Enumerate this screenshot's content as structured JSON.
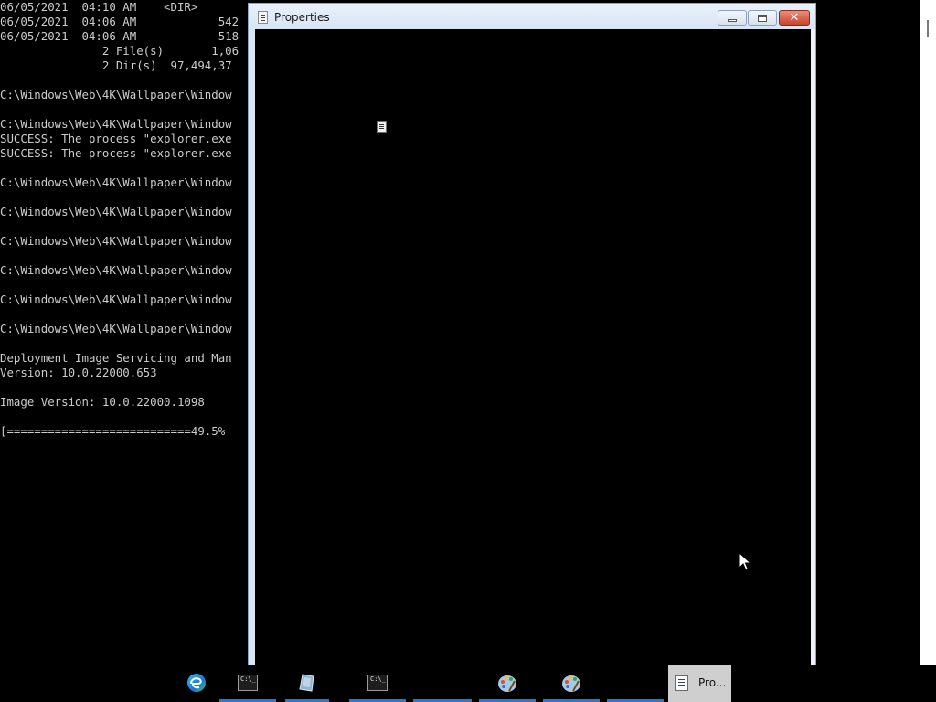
{
  "console": {
    "lines": [
      "06/05/2021  04:10 AM    <DIR>",
      "06/05/2021  04:06 AM            542",
      "06/05/2021  04:06 AM            518",
      "               2 File(s)       1,06",
      "               2 Dir(s)  97,494,37",
      "",
      "C:\\Windows\\Web\\4K\\Wallpaper\\Window",
      "",
      "C:\\Windows\\Web\\4K\\Wallpaper\\Window",
      "SUCCESS: The process \"explorer.exe",
      "SUCCESS: The process \"explorer.exe",
      "",
      "C:\\Windows\\Web\\4K\\Wallpaper\\Window",
      "",
      "C:\\Windows\\Web\\4K\\Wallpaper\\Window",
      "",
      "C:\\Windows\\Web\\4K\\Wallpaper\\Window",
      "",
      "C:\\Windows\\Web\\4K\\Wallpaper\\Window",
      "",
      "C:\\Windows\\Web\\4K\\Wallpaper\\Window",
      "",
      "C:\\Windows\\Web\\4K\\Wallpaper\\Window",
      "",
      "Deployment Image Servicing and Man",
      "Version: 10.0.22000.653",
      "",
      "Image Version: 10.0.22000.1098",
      "",
      "[===========================49.5%"
    ],
    "progress_percent": 49.5
  },
  "properties_window": {
    "title": "Properties",
    "close_glyph": "✕"
  },
  "taskbar": {
    "items": [
      {
        "name": "edge",
        "icon": "edge-icon",
        "running": false
      },
      {
        "name": "command-prompt",
        "icon": "cmd-icon",
        "running": true
      },
      {
        "name": "ink",
        "icon": "ink-icon",
        "running": true
      },
      {
        "name": "command-prompt-2",
        "icon": "cmd-icon",
        "running": true
      },
      {
        "name": "blank",
        "icon": "",
        "running": true
      },
      {
        "name": "paint",
        "icon": "paint-icon",
        "running": true
      },
      {
        "name": "paint-2",
        "icon": "paint-icon",
        "running": true
      },
      {
        "name": "blank-2",
        "icon": "",
        "running": true
      },
      {
        "name": "properties",
        "icon": "properties-icon",
        "running": true,
        "active": true
      }
    ],
    "properties_label": "Pro...",
    "cmd_icon_text": "C:\\_"
  },
  "colors": {
    "console_text": "#cccccc",
    "taskbar_indicator": "#2d76c8",
    "close_button": "#c8442c"
  }
}
